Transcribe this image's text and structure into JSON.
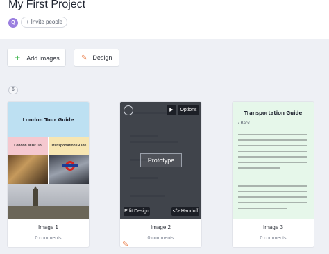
{
  "project": {
    "title": "My First Project"
  },
  "header": {
    "avatar_initial": "Q",
    "invite_label": "Invite people",
    "invite_icon": "plus-icon"
  },
  "toolbar": {
    "add_images_label": "Add images",
    "add_images_icon": "plus-icon",
    "design_label": "Design",
    "design_icon": "pencil-icon",
    "accent_green": "#3bb54a",
    "accent_orange": "#e8743b"
  },
  "screens": {
    "count": "6",
    "items": [
      {
        "name": "Image 1",
        "comments": "0 comments",
        "thumb_texts": {
          "title": "London Tour Guide",
          "left_label": "London Must Do",
          "right_label": "Transportation Guide"
        }
      },
      {
        "name": "Image 2",
        "comments": "0 comments",
        "overlay": {
          "prototype_label": "Prototype",
          "options_label": "Options",
          "edit_design_label": "Edit Design",
          "handoff_label": "Handoff",
          "play_icon": "play-icon",
          "code_icon": "code-icon"
        }
      },
      {
        "name": "Image 3",
        "comments": "0 comments",
        "thumb_texts": {
          "title": "Transportation Guide",
          "back_label": "Back"
        }
      }
    ]
  }
}
